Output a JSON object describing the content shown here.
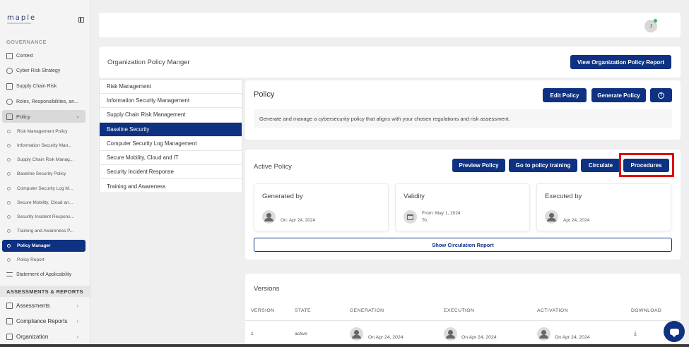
{
  "brand": {
    "name": "maple"
  },
  "sidebar": {
    "governance_heading": "GOVERNANCE",
    "items": [
      {
        "label": "Context"
      },
      {
        "label": "Cyber Risk Strategy"
      },
      {
        "label": "Supply Chain Risk"
      },
      {
        "label": "Roles, Responsibilities, an..."
      }
    ],
    "policy": {
      "label": "Policy",
      "chevron": "chevron-down-icon"
    },
    "policy_subitems": [
      {
        "label": "Risk Management Policy"
      },
      {
        "label": "Information Security Man..."
      },
      {
        "label": "Supply Chain Risk Manag..."
      },
      {
        "label": "Baseline Security Policy"
      },
      {
        "label": "Computer Security Log M..."
      },
      {
        "label": "Secure Mobility, Cloud an..."
      },
      {
        "label": "Security Incident Respons..."
      },
      {
        "label": "Training and Awareness P..."
      },
      {
        "label": "Policy Manager"
      },
      {
        "label": "Policy Report"
      }
    ],
    "soa": {
      "label": "Statement of Applicability"
    },
    "assessments_heading": "ASSESSMENTS & REPORTS",
    "bottom_items": [
      {
        "label": "Assessments"
      },
      {
        "label": "Compliance Reports"
      },
      {
        "label": "Organization"
      }
    ]
  },
  "topbar": {
    "avatar_initial": "J"
  },
  "header": {
    "title": "Organization Policy Manger",
    "report_button": "View Organization Policy Report"
  },
  "policy_list": [
    "Risk Management",
    "Information Security Management",
    "Supply Chain Risk Management",
    "Baseline Security",
    "Computer Security Log Management",
    "Secure Mobility, Cloud and IT",
    "Security Incident Response",
    "Training and Awareness"
  ],
  "policy": {
    "title": "Policy",
    "edit_button": "Edit Policy",
    "generate_button": "Generate Policy",
    "help_icon": "?",
    "description": "Generate and manage a cybersecurity policy that aligns with your chosen regulations and risk assessment."
  },
  "active_policy": {
    "title": "Active Policy",
    "preview_button": "Preview Policy",
    "training_button": "Go to policy training",
    "circulate_button": "Circulate",
    "procedures_button": "Procedures",
    "generated": {
      "heading": "Generated by",
      "text": "On: Apr 24, 2024"
    },
    "validity": {
      "heading": "Validity",
      "from": "From: May 1, 2024",
      "to": "To:"
    },
    "executed": {
      "heading": "Executed by",
      "text": "Apr 24, 2024"
    },
    "show_report_button": "Show Circulation Report"
  },
  "versions": {
    "title": "Versions",
    "columns": [
      "VERSION",
      "STATE",
      "GENERATION",
      "EXECUTION",
      "ACTIVATION",
      "DOWNLOAD"
    ],
    "rows": [
      {
        "version": "1",
        "state": "active",
        "generation": "On Apr 24, 2024",
        "execution": "On Apr 24, 2024",
        "activation": "On Apr 24, 2024"
      }
    ]
  },
  "colors": {
    "primary": "#0e3281",
    "highlight": "#e00000",
    "online": "#2ebd59"
  }
}
